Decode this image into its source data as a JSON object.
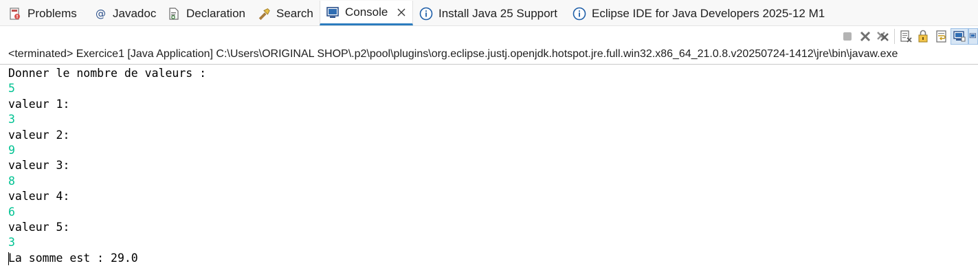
{
  "tabs": [
    {
      "label": "Problems",
      "icon": "problems-icon"
    },
    {
      "label": "Javadoc",
      "icon": "at-icon"
    },
    {
      "label": "Declaration",
      "icon": "declaration-icon"
    },
    {
      "label": "Search",
      "icon": "search-flashlight-icon"
    },
    {
      "label": "Console",
      "icon": "console-icon",
      "active": true,
      "close": "×"
    },
    {
      "label": "Install Java 25 Support",
      "icon": "info-icon"
    },
    {
      "label": "Eclipse IDE for Java Developers 2025-12 M1",
      "icon": "info-icon"
    }
  ],
  "toolbar": [
    "terminate-icon",
    "remove-launch-icon",
    "remove-all-terminated-icon",
    "clear-console-icon",
    "scroll-lock-icon",
    "word-wrap-icon",
    "show-console-on-output-icon",
    "show-console-on-error-icon"
  ],
  "process_line": "<terminated> Exercice1 [Java Application] C:\\Users\\ORIGINAL SHOP\\.p2\\pool\\plugins\\org.eclipse.justj.openjdk.hotspot.jre.full.win32.x86_64_21.0.8.v20250724-1412\\jre\\bin\\javaw.exe",
  "console": {
    "lines": [
      {
        "text": "Donner le nombre de valeurs :",
        "kind": "out"
      },
      {
        "text": "5",
        "kind": "in"
      },
      {
        "text": "valeur 1:",
        "kind": "out"
      },
      {
        "text": "3",
        "kind": "in"
      },
      {
        "text": "valeur 2:",
        "kind": "out"
      },
      {
        "text": "9",
        "kind": "in"
      },
      {
        "text": "valeur 3:",
        "kind": "out"
      },
      {
        "text": "8",
        "kind": "in"
      },
      {
        "text": "valeur 4:",
        "kind": "out"
      },
      {
        "text": "6",
        "kind": "in"
      },
      {
        "text": "valeur 5:",
        "kind": "out"
      },
      {
        "text": "3",
        "kind": "in"
      },
      {
        "text": "La somme est : 29.0",
        "kind": "out"
      }
    ]
  },
  "colors": {
    "input_text": "#00c292",
    "output_text": "#000000",
    "active_tab_underline": "#2c7cbf",
    "info_icon": "#1f5fa8"
  }
}
